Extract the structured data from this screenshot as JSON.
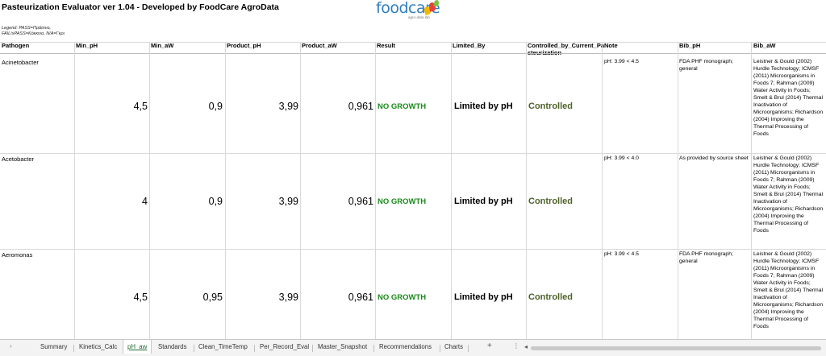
{
  "title": "Pasteurization Evaluator ver 1.04 - Developed by FoodCare AgroData",
  "logo": {
    "word": "foodcare",
    "tagline": "agro·data·lab",
    "icon": "fruit-drops-icon",
    "colors": [
      "#f5b800",
      "#e8403a",
      "#7cc242"
    ]
  },
  "legend": [
    "Legend: PASS=Πράσινο,",
    "FAIL/xPASS=Κόκκινο, N/A=Γκρι"
  ],
  "columns": [
    "Pathogen",
    "Min_pH",
    "Min_aW",
    "Product_pH",
    "Product_aW",
    "Result",
    "Limited_By",
    "Controlled_by_Current_Pa",
    "Note",
    "Bib_pH",
    "Bib_aW"
  ],
  "column_wrap": "steurization",
  "rows": [
    {
      "pathogen": "Acinetobacter",
      "min_ph": "4,5",
      "min_aw": "0,9",
      "product_ph": "3,99",
      "product_aw": "0,961",
      "result": "NO GROWTH",
      "limited_by": "Limited by pH",
      "controlled": "Controlled",
      "note": "pH: 3.99 < 4.5",
      "bib_ph": "FDA PHF monograph; general",
      "bib_aw": "Leistner & Gould (2002) Hurdle Technology; ICMSF (2011) Microorganisms in Foods 7; Rahman (2009) Water Activity in Foods; Smelt & Brul (2014) Thermal Inactivation of Microorganisms; Richardson (2004) Improving the Thermal Processing of Foods"
    },
    {
      "pathogen": "Acetobacter",
      "min_ph": "4",
      "min_aw": "0,9",
      "product_ph": "3,99",
      "product_aw": "0,961",
      "result": "NO GROWTH",
      "limited_by": "Limited by pH",
      "controlled": "Controlled",
      "note": "pH: 3.99 < 4.0",
      "bib_ph": "As provided by source sheet",
      "bib_aw": "Leistner & Gould (2002) Hurdle Technology; ICMSF (2011) Microorganisms in Foods 7; Rahman (2009) Water Activity in Foods; Smelt & Brul (2014) Thermal Inactivation of Microorganisms; Richardson (2004) Improving the Thermal Processing of Foods"
    },
    {
      "pathogen": "Aeromonas",
      "min_ph": "4,5",
      "min_aw": "0,95",
      "product_ph": "3,99",
      "product_aw": "0,961",
      "result": "NO GROWTH",
      "limited_by": "Limited by pH",
      "controlled": "Controlled",
      "note": "pH: 3.99 < 4.5",
      "bib_ph": "FDA PHF monograph; general",
      "bib_aw": "Leistner & Gould (2002) Hurdle Technology; ICMSF (2011) Microorganisms in Foods 7; Rahman (2009) Water Activity in Foods; Smelt & Brul (2014) Thermal Inactivation of Microorganisms; Richardson (2004) Improving the Thermal Processing of Foods"
    }
  ],
  "tabs": [
    "Summary",
    "Kinetics_Calc",
    "pH_aw",
    "Standards",
    "Clean_TimeTemp",
    "Per_Record_Eval",
    "Master_Snapshot",
    "Recommendations",
    "Charts"
  ],
  "active_tab": "pH_aw",
  "tab_controls": {
    "prev": "›",
    "add": "+",
    "more": "⋮",
    "scroll_left": "◂"
  },
  "colors": {
    "result": "#1a8a1a",
    "controlled": "#4f6228"
  }
}
